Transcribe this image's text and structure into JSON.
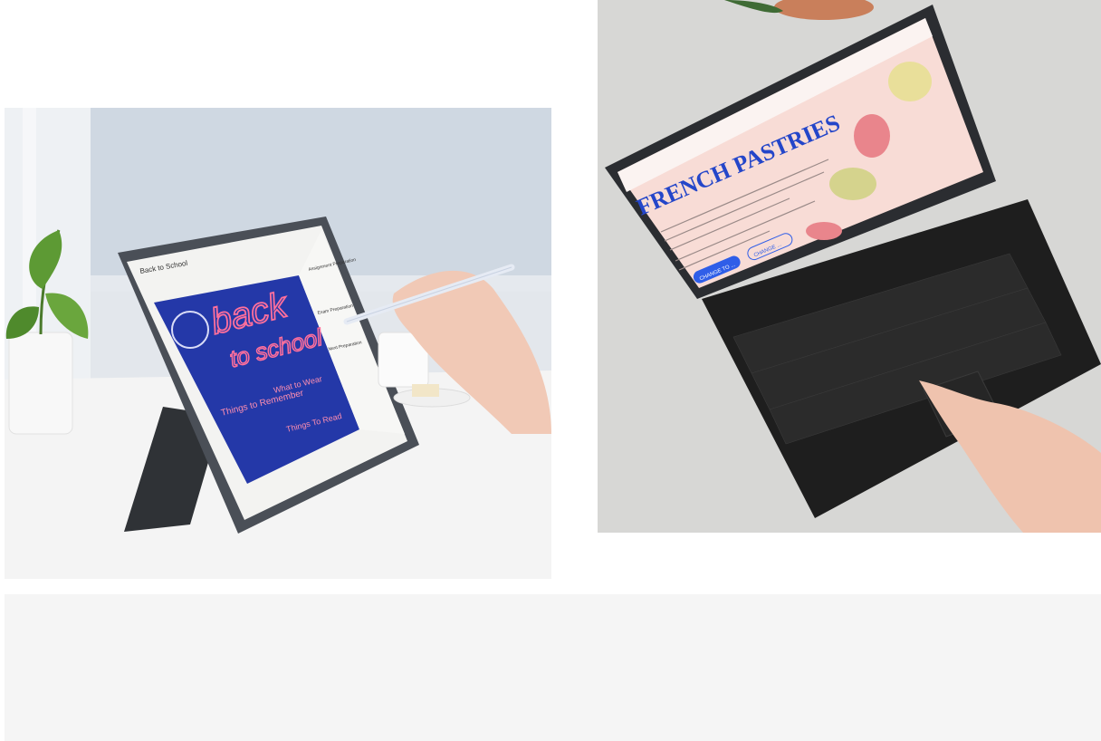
{
  "left_photo": {
    "screen": {
      "app_title": "Back to School",
      "headline_line1": "back",
      "headline_line2": "to school",
      "things_to_remember": "Things to Remember",
      "what_to_wear": "What to Wear",
      "things_to_read": "Things To Read",
      "sidebar_item_1": "Assignment Preparation",
      "sidebar_item_2": "Exam Preparation",
      "sidebar_item_3": "Next Preparation"
    }
  },
  "right_photo": {
    "screen": {
      "headline": "FRENCH PASTRIES",
      "button_primary": "CHANGE TO ...",
      "button_secondary": "CHANGE ..."
    }
  },
  "colors": {
    "page_bg": "#ffffff",
    "bottom_band": "#f5f5f5",
    "notes_blue": "#2438a8",
    "notes_pink": "#ff6f9c",
    "pastry_pink": "#f7c8c4",
    "headline_blue": "#2446c9",
    "keyboard": "#1e1e1e"
  }
}
